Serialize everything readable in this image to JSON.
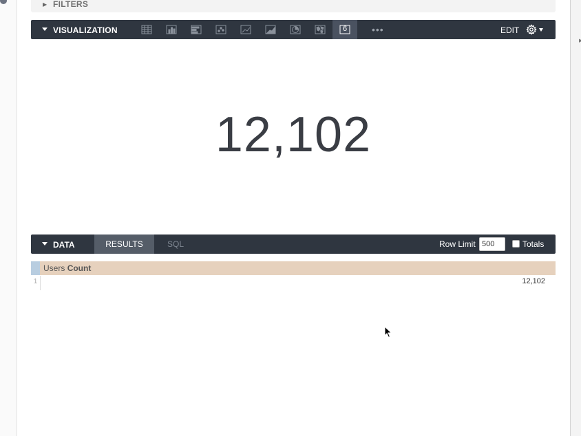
{
  "filters": {
    "label": "FILTERS"
  },
  "visualization": {
    "label": "VISUALIZATION",
    "icons": [
      "table-icon",
      "column-chart-icon",
      "bar-chart-icon",
      "scatter-icon",
      "line-chart-icon",
      "area-chart-icon",
      "pie-chart-icon",
      "map-icon",
      "single-value-icon",
      "more-icon"
    ],
    "single_value_glyph": "6",
    "more_label": "•••",
    "edit_label": "EDIT"
  },
  "single_value": "12,102",
  "data": {
    "label": "DATA",
    "tabs": {
      "results": "RESULTS",
      "sql": "SQL"
    },
    "row_limit_label": "Row Limit",
    "row_limit_value": "500",
    "totals_label": "Totals"
  },
  "table": {
    "header": {
      "view": "Users",
      "field": "Count"
    },
    "rows": [
      {
        "num": "1",
        "value": "12,102"
      }
    ]
  },
  "colors": {
    "toolbar_bg": "#2f3640",
    "active_tab_bg": "#555d68",
    "header_bg": "#e6d1bd",
    "corner_bg": "#b8cde0",
    "value_text": "#3a3d44"
  }
}
